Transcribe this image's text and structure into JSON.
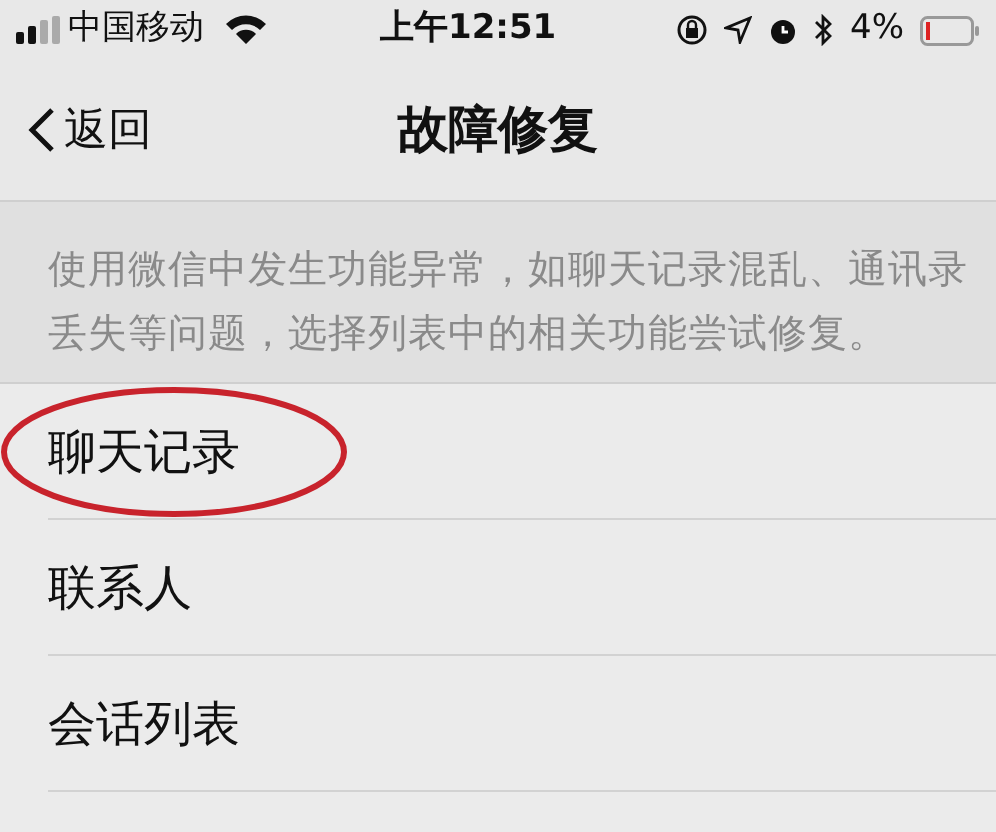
{
  "status_bar": {
    "carrier": "中国移动",
    "time": "上午12:51",
    "battery": "4%"
  },
  "nav": {
    "back": "返回",
    "title": "故障修复"
  },
  "description": "使用微信中发生功能异常，如聊天记录混乱、通讯录丢失等问题，选择列表中的相关功能尝试修复。",
  "items": [
    {
      "label": "聊天记录",
      "circled": true
    },
    {
      "label": "联系人",
      "circled": false
    },
    {
      "label": "会话列表",
      "circled": false
    }
  ]
}
